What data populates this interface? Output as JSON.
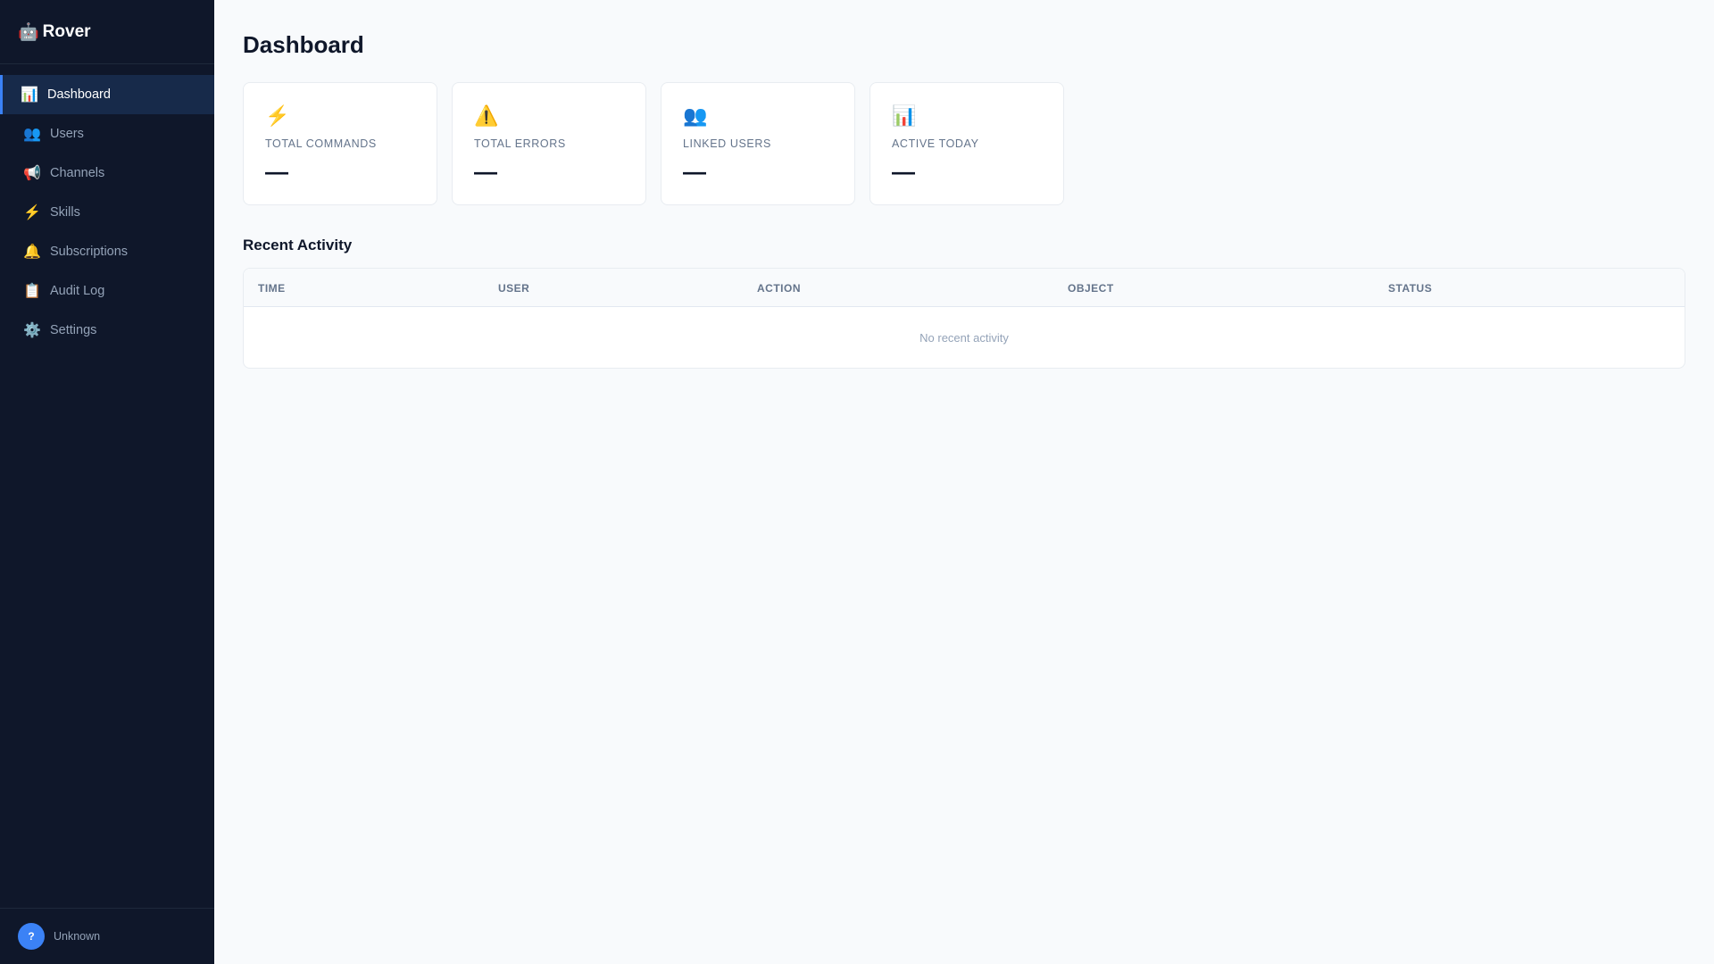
{
  "app": {
    "logo_icon": "🤖",
    "name": "Rover"
  },
  "sidebar": {
    "items": [
      {
        "icon": "📊",
        "label": "Dashboard",
        "active": true
      },
      {
        "icon": "👥",
        "label": "Users"
      },
      {
        "icon": "📢",
        "label": "Channels"
      },
      {
        "icon": "⚡",
        "label": "Skills"
      },
      {
        "icon": "🔔",
        "label": "Subscriptions"
      },
      {
        "icon": "📋",
        "label": "Audit Log"
      },
      {
        "icon": "⚙️",
        "label": "Settings"
      }
    ],
    "user": {
      "avatar": "?",
      "name": "Unknown"
    }
  },
  "page": {
    "title": "Dashboard"
  },
  "stats": [
    {
      "icon": "⚡",
      "label": "TOTAL COMMANDS",
      "value": "—"
    },
    {
      "icon": "⚠️",
      "label": "TOTAL ERRORS",
      "value": "—"
    },
    {
      "icon": "👥",
      "label": "LINKED USERS",
      "value": "—"
    },
    {
      "icon": "📊",
      "label": "ACTIVE TODAY",
      "value": "—"
    }
  ],
  "activity": {
    "title": "Recent Activity",
    "columns": [
      "TIME",
      "USER",
      "ACTION",
      "OBJECT",
      "STATUS"
    ],
    "empty": "No recent activity"
  },
  "colors": {
    "sidebar": "#0f172a",
    "accent": "#3b82f6"
  }
}
